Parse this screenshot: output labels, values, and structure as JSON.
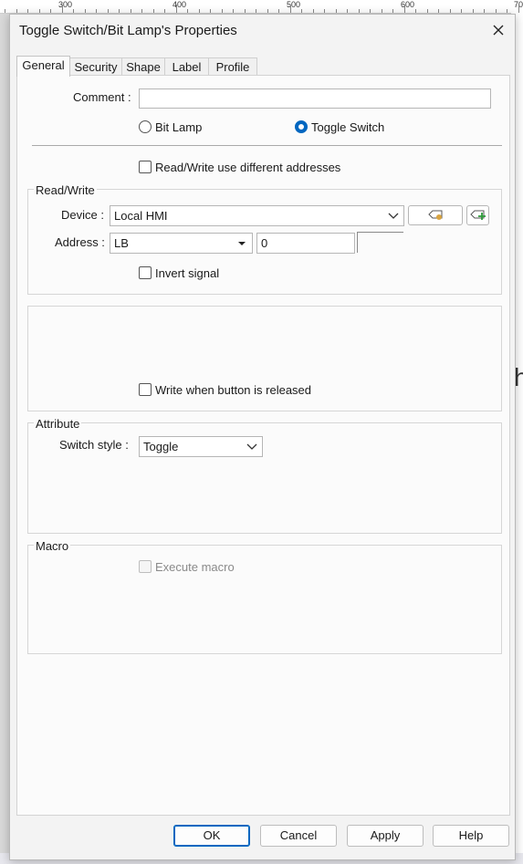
{
  "ruler": {
    "labels": [
      "300",
      "400",
      "500",
      "600",
      "70"
    ]
  },
  "backdrop": {
    "glyph_a": "h"
  },
  "dialog": {
    "title": "Toggle Switch/Bit Lamp's Properties",
    "close_icon": "close-icon"
  },
  "tabs": [
    {
      "label": "General",
      "active": true
    },
    {
      "label": "Security",
      "active": false
    },
    {
      "label": "Shape",
      "active": false
    },
    {
      "label": "Label",
      "active": false
    },
    {
      "label": "Profile",
      "active": false
    }
  ],
  "general": {
    "comment_label": "Comment :",
    "comment_value": "",
    "mode_options": [
      {
        "label": "Bit Lamp",
        "selected": false
      },
      {
        "label": "Toggle Switch",
        "selected": true
      }
    ],
    "diff_addr_label": "Read/Write use different addresses",
    "diff_addr_checked": false
  },
  "read_write": {
    "group_title": "Read/Write",
    "device_label": "Device :",
    "device_value": "Local HMI",
    "address_label": "Address :",
    "address_type": "LB",
    "address_value": "0",
    "invert_label": "Invert signal",
    "invert_checked": false,
    "device_tag_icon": "tag-settings-icon",
    "device_add_icon": "tag-add-icon"
  },
  "write_options": {
    "release_label": "Write when button is released",
    "release_checked": false
  },
  "attribute": {
    "group_title": "Attribute",
    "switch_style_label": "Switch style :",
    "switch_style_value": "Toggle"
  },
  "macro": {
    "group_title": "Macro",
    "execute_label": "Execute macro",
    "execute_checked": false,
    "execute_enabled": false
  },
  "buttons": {
    "ok": "OK",
    "cancel": "Cancel",
    "apply": "Apply",
    "help": "Help"
  },
  "colors": {
    "accent": "#0067c0",
    "panel_bg": "#fbfbfb",
    "dialog_bg": "#f3f3f3"
  }
}
